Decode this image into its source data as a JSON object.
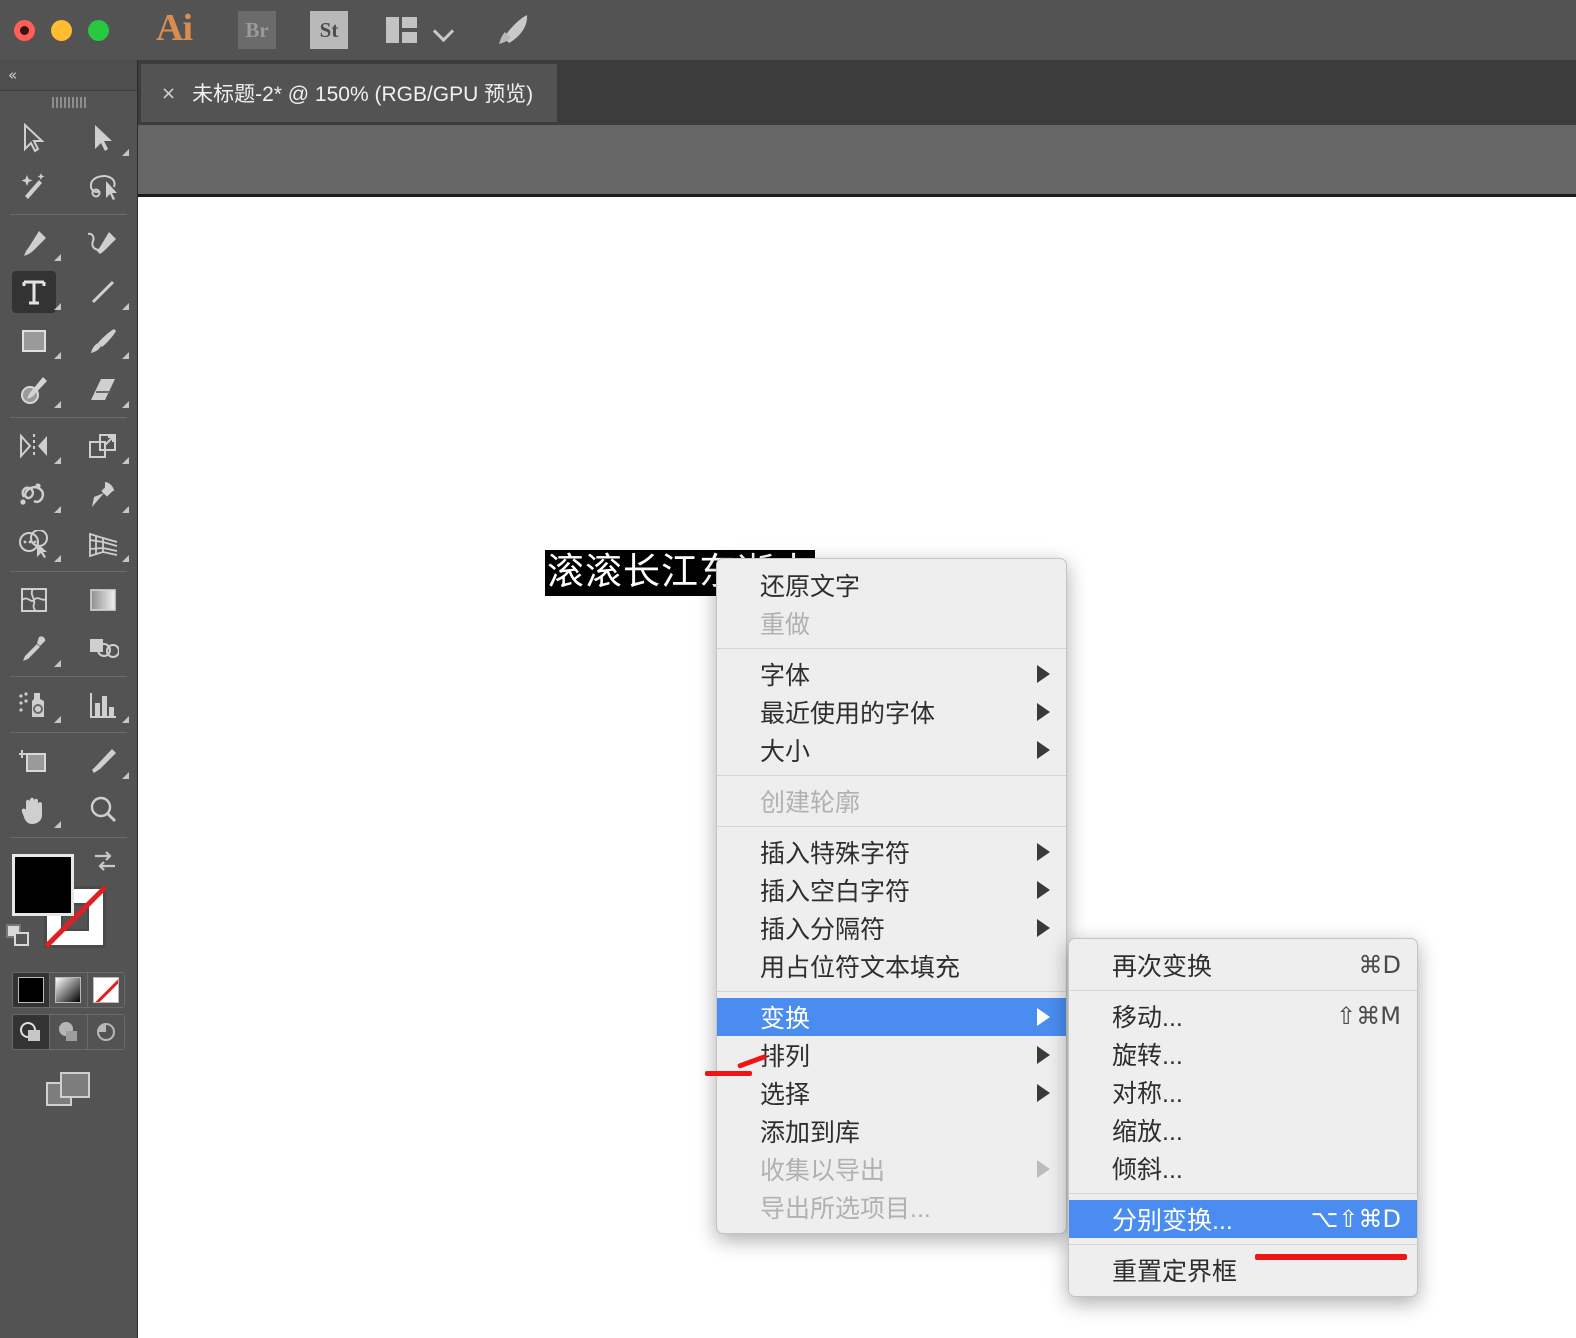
{
  "window": {
    "traffic_lights": [
      "close",
      "minimize",
      "maximize"
    ],
    "app_logo": "Ai",
    "apps": [
      {
        "icon": "bridge-badge",
        "label": "Br"
      },
      {
        "icon": "stock-badge",
        "label": "St"
      }
    ],
    "workspace_switcher_icon": "workspace-layout-icon",
    "workspace_chevron_icon": "chevron-down-icon",
    "launch_icon": "rocket-icon"
  },
  "tools_panel": {
    "collapse_label": "«",
    "grip": "panel-drag-handle",
    "tools": [
      {
        "name": "selection-tool",
        "icon": "arrow-cursor-icon",
        "has_flyout": false,
        "active": false
      },
      {
        "name": "direct-selection-tool",
        "icon": "solid-arrow-icon",
        "has_flyout": true,
        "active": false
      },
      {
        "name": "magic-wand-tool",
        "icon": "magic-wand-icon",
        "has_flyout": false,
        "active": false
      },
      {
        "name": "lasso-tool",
        "icon": "lasso-icon",
        "has_flyout": false,
        "active": false
      },
      {
        "name": "pen-tool",
        "icon": "pen-nib-icon",
        "has_flyout": true,
        "active": false
      },
      {
        "name": "curvature-tool",
        "icon": "curvature-pen-icon",
        "has_flyout": false,
        "active": false
      },
      {
        "name": "type-tool",
        "icon": "type-t-icon",
        "has_flyout": true,
        "active": true
      },
      {
        "name": "line-segment-tool",
        "icon": "line-segment-icon",
        "has_flyout": true,
        "active": false
      },
      {
        "name": "rectangle-tool",
        "icon": "rectangle-icon",
        "has_flyout": true,
        "active": false
      },
      {
        "name": "paintbrush-tool",
        "icon": "paintbrush-icon",
        "has_flyout": true,
        "active": false
      },
      {
        "name": "shaper-tool",
        "icon": "shaper-pencil-icon",
        "has_flyout": true,
        "active": false
      },
      {
        "name": "eraser-tool",
        "icon": "eraser-icon",
        "has_flyout": true,
        "active": false
      },
      {
        "name": "rotate-tool",
        "icon": "reflect-icon",
        "has_flyout": true,
        "active": false
      },
      {
        "name": "scale-tool",
        "icon": "scale-arrow-icon",
        "has_flyout": true,
        "active": false
      },
      {
        "name": "width-tool",
        "icon": "warp-twirl-icon",
        "has_flyout": true,
        "active": false
      },
      {
        "name": "free-transform-tool",
        "icon": "pushpin-icon",
        "has_flyout": true,
        "active": false
      },
      {
        "name": "shape-builder-tool",
        "icon": "shape-builder-icon",
        "has_flyout": true,
        "active": false
      },
      {
        "name": "perspective-grid-tool",
        "icon": "perspective-grid-icon",
        "has_flyout": true,
        "active": false
      },
      {
        "name": "mesh-tool",
        "icon": "mesh-icon",
        "has_flyout": false,
        "active": false
      },
      {
        "name": "gradient-tool",
        "icon": "gradient-icon",
        "has_flyout": false,
        "active": false
      },
      {
        "name": "eyedropper-tool",
        "icon": "eyedropper-icon",
        "has_flyout": true,
        "active": false
      },
      {
        "name": "blend-tool",
        "icon": "blend-icon",
        "has_flyout": false,
        "active": false
      },
      {
        "name": "symbol-sprayer-tool",
        "icon": "symbol-sprayer-icon",
        "has_flyout": true,
        "active": false
      },
      {
        "name": "column-graph-tool",
        "icon": "bar-chart-icon",
        "has_flyout": true,
        "active": false
      },
      {
        "name": "artboard-tool",
        "icon": "artboard-icon",
        "has_flyout": false,
        "active": false
      },
      {
        "name": "slice-tool",
        "icon": "slice-knife-icon",
        "has_flyout": true,
        "active": false
      },
      {
        "name": "hand-tool",
        "icon": "hand-icon",
        "has_flyout": true,
        "active": false
      },
      {
        "name": "zoom-tool",
        "icon": "magnifier-icon",
        "has_flyout": false,
        "active": false
      }
    ],
    "color_controls": {
      "fill_color": "#000000",
      "stroke_color": "none",
      "swap_icon": "swap-arrows-icon",
      "default_icon": "default-fill-stroke-icon"
    },
    "paint_modes": [
      {
        "name": "color-swatch",
        "icon": "solid-color-icon",
        "selected": true
      },
      {
        "name": "gradient-swatch",
        "icon": "gradient-fill-icon",
        "selected": false
      },
      {
        "name": "none-swatch",
        "icon": "none-fill-icon",
        "selected": false
      }
    ],
    "draw_modes": [
      {
        "name": "draw-normal",
        "icon": "draw-normal-icon",
        "selected": true
      },
      {
        "name": "draw-behind",
        "icon": "draw-behind-icon",
        "selected": false
      },
      {
        "name": "draw-inside",
        "icon": "draw-inside-icon",
        "selected": false
      }
    ],
    "screen_mode": {
      "name": "change-screen-mode",
      "icon": "screen-mode-icon"
    }
  },
  "document": {
    "tab_close_icon": "×",
    "tab_title": "未标题-2* @ 150% (RGB/GPU 预览)",
    "artboard_text": "滚滚长江东逝水"
  },
  "context_menu": {
    "items": [
      {
        "label": "还原文字",
        "submenu": false,
        "disabled": false,
        "highlighted": false,
        "shortcut": ""
      },
      {
        "label": "重做",
        "submenu": false,
        "disabled": true,
        "highlighted": false,
        "shortcut": ""
      },
      {
        "separator": true
      },
      {
        "label": "字体",
        "submenu": true,
        "disabled": false,
        "highlighted": false,
        "shortcut": ""
      },
      {
        "label": "最近使用的字体",
        "submenu": true,
        "disabled": false,
        "highlighted": false,
        "shortcut": ""
      },
      {
        "label": "大小",
        "submenu": true,
        "disabled": false,
        "highlighted": false,
        "shortcut": ""
      },
      {
        "separator": true
      },
      {
        "label": "创建轮廓",
        "submenu": false,
        "disabled": true,
        "highlighted": false,
        "shortcut": ""
      },
      {
        "separator": true
      },
      {
        "label": "插入特殊字符",
        "submenu": true,
        "disabled": false,
        "highlighted": false,
        "shortcut": ""
      },
      {
        "label": "插入空白字符",
        "submenu": true,
        "disabled": false,
        "highlighted": false,
        "shortcut": ""
      },
      {
        "label": "插入分隔符",
        "submenu": true,
        "disabled": false,
        "highlighted": false,
        "shortcut": ""
      },
      {
        "label": "用占位符文本填充",
        "submenu": false,
        "disabled": false,
        "highlighted": false,
        "shortcut": ""
      },
      {
        "separator": true
      },
      {
        "label": "变换",
        "submenu": true,
        "disabled": false,
        "highlighted": true,
        "shortcut": ""
      },
      {
        "label": "排列",
        "submenu": true,
        "disabled": false,
        "highlighted": false,
        "shortcut": ""
      },
      {
        "label": "选择",
        "submenu": true,
        "disabled": false,
        "highlighted": false,
        "shortcut": ""
      },
      {
        "label": "添加到库",
        "submenu": false,
        "disabled": false,
        "highlighted": false,
        "shortcut": ""
      },
      {
        "label": "收集以导出",
        "submenu": true,
        "disabled": true,
        "highlighted": false,
        "shortcut": ""
      },
      {
        "label": "导出所选项目...",
        "submenu": false,
        "disabled": true,
        "highlighted": false,
        "shortcut": ""
      }
    ]
  },
  "transform_submenu": {
    "items": [
      {
        "label": "再次变换",
        "shortcut": "⌘D",
        "disabled": false,
        "highlighted": false
      },
      {
        "separator": true
      },
      {
        "label": "移动...",
        "shortcut": "⇧⌘M",
        "disabled": false,
        "highlighted": false
      },
      {
        "label": "旋转...",
        "shortcut": "",
        "disabled": false,
        "highlighted": false
      },
      {
        "label": "对称...",
        "shortcut": "",
        "disabled": false,
        "highlighted": false
      },
      {
        "label": "缩放...",
        "shortcut": "",
        "disabled": false,
        "highlighted": false
      },
      {
        "label": "倾斜...",
        "shortcut": "",
        "disabled": false,
        "highlighted": false
      },
      {
        "separator": true
      },
      {
        "label": "分别变换...",
        "shortcut": "⌥⇧⌘D",
        "disabled": false,
        "highlighted": true
      },
      {
        "separator": true
      },
      {
        "label": "重置定界框",
        "shortcut": "",
        "disabled": false,
        "highlighted": false
      }
    ]
  },
  "annotations": {
    "pointer_color": "#f01414",
    "underline_color": "#f01414"
  },
  "colors": {
    "chrome": "#535353",
    "menu_bg": "#eeeeee",
    "highlight": "#4a8cf0",
    "accent": "#d98c4f"
  }
}
